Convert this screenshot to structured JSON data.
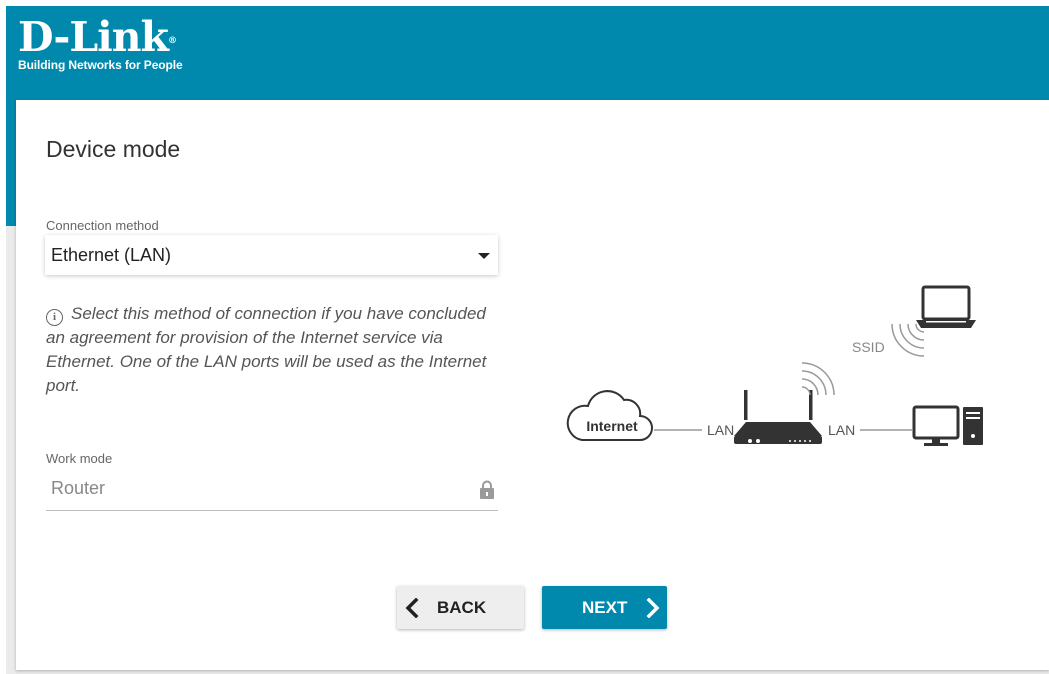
{
  "brand": {
    "name": "D-Link",
    "registered": "®",
    "tagline": "Building Networks for People"
  },
  "page": {
    "title": "Device mode"
  },
  "connection_method": {
    "label": "Connection method",
    "value": "Ethernet (LAN)",
    "hint": "Select this method of connection if you have concluded an agreement for provision of the Internet service via Ethernet. One of the LAN ports will be used as the Internet port."
  },
  "work_mode": {
    "label": "Work mode",
    "value": "Router"
  },
  "diagram": {
    "internet_label": "Internet",
    "lan_left": "LAN",
    "lan_right": "LAN",
    "ssid_label": "SSID"
  },
  "buttons": {
    "back": "BACK",
    "next": "NEXT"
  },
  "colors": {
    "brand_teal": "#0089ad",
    "card_bg": "#ffffff",
    "back_button_bg": "#eeeeee"
  },
  "icons": {
    "info": "info-circle-icon",
    "lock": "lock-icon",
    "dropdown": "caret-down-icon",
    "back": "chevron-left-icon",
    "next": "chevron-right-icon"
  }
}
